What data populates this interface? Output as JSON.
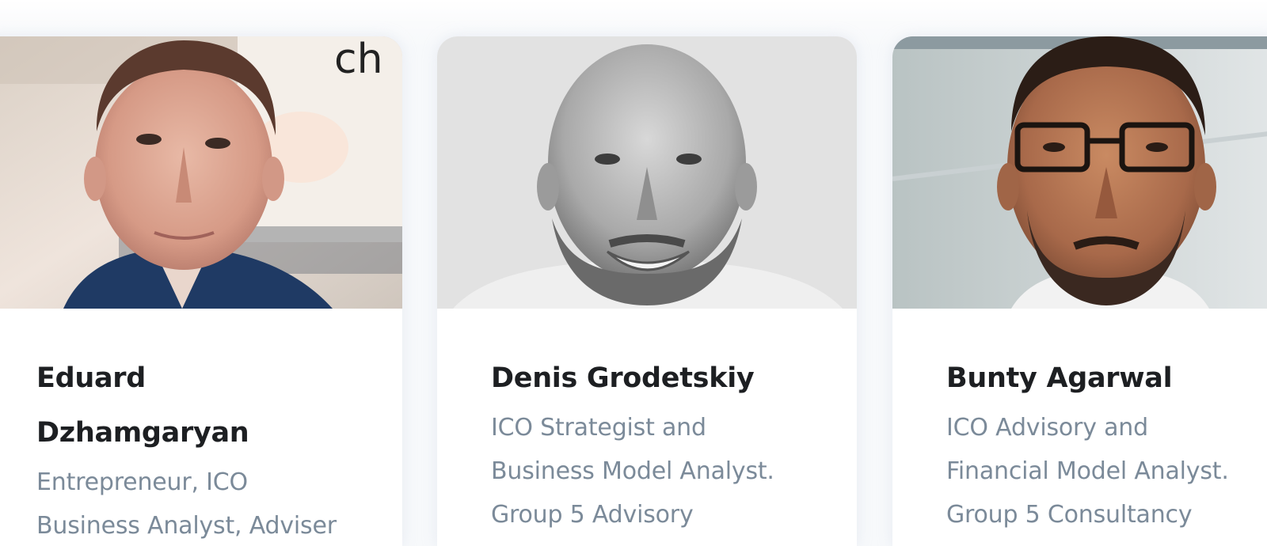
{
  "team": {
    "members": [
      {
        "name_lines": [
          "Eduard",
          "Dzhamgaryan"
        ],
        "role_lines": [
          "Entrepreneur, ICO",
          "Business Analyst, Adviser"
        ],
        "photo_icon": "portrait-photo",
        "photo_sign_text": "ch"
      },
      {
        "name_lines": [
          "Denis Grodetskiy"
        ],
        "role_lines": [
          "ICO Strategist and",
          "Business Model Analyst.",
          "Group 5 Advisory"
        ],
        "photo_icon": "portrait-photo"
      },
      {
        "name_lines": [
          "Bunty Agarwal"
        ],
        "role_lines": [
          "ICO Advisory and",
          "Financial Model Analyst.",
          "Group 5 Consultancy"
        ],
        "photo_icon": "portrait-photo"
      }
    ]
  },
  "colors": {
    "name_text": "#1d1f22",
    "role_text": "#7b8a99",
    "card_bg": "#ffffff",
    "page_bg": "#f7f9fb"
  }
}
